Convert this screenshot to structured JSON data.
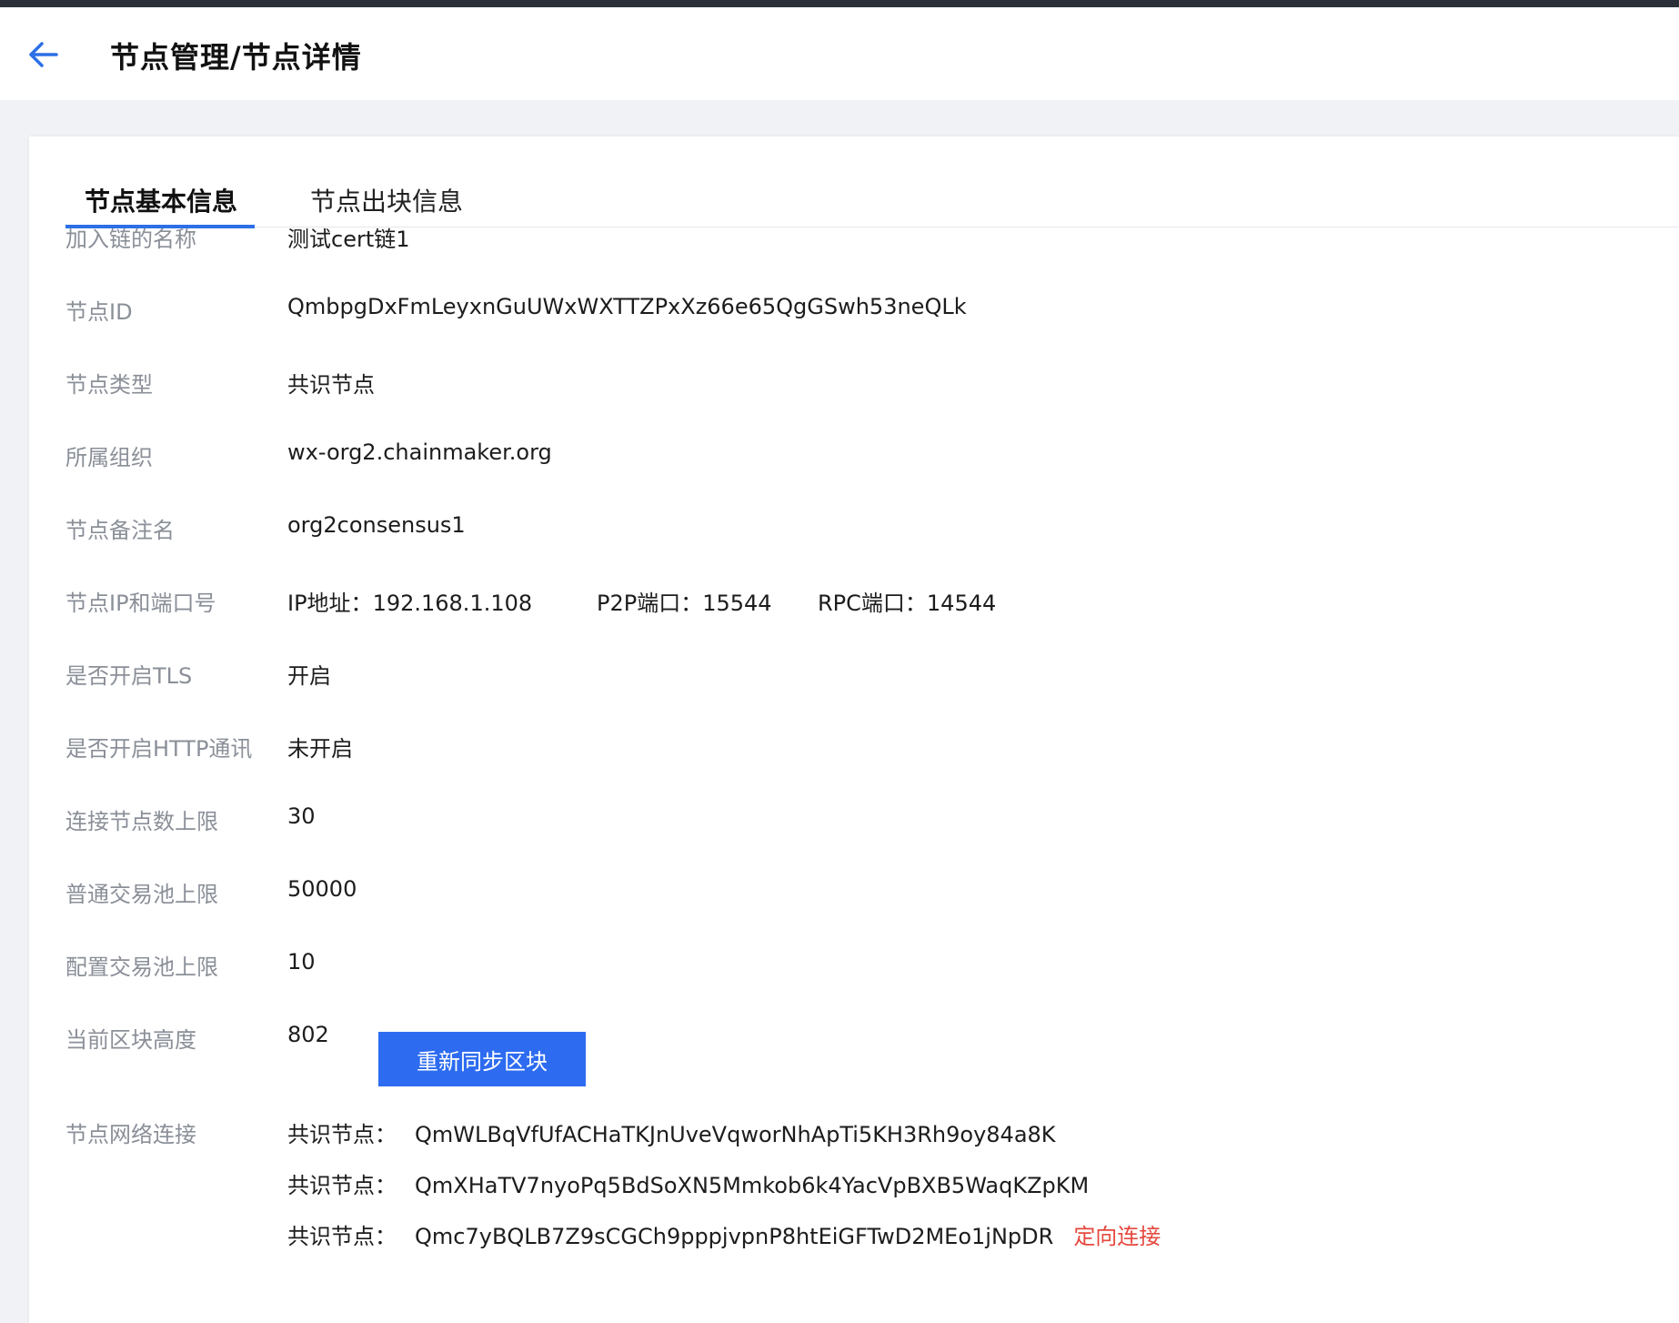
{
  "header": {
    "title": "节点管理/节点详情"
  },
  "tabs": [
    {
      "label": "节点基本信息",
      "active": true
    },
    {
      "label": "节点出块信息",
      "active": false
    }
  ],
  "details": {
    "chain_name": {
      "label": "加入链的名称",
      "value": "测试cert链1"
    },
    "node_id": {
      "label": "节点ID",
      "value": "QmbpgDxFmLeyxnGuUWxWXTTZPxXz66e65QgGSwh53neQLk"
    },
    "node_type": {
      "label": "节点类型",
      "value": "共识节点"
    },
    "org": {
      "label": "所属组织",
      "value": "wx-org2.chainmaker.org"
    },
    "remark": {
      "label": "节点备注名",
      "value": "org2consensus1"
    },
    "ip_ports": {
      "label": "节点IP和端口号",
      "ip_label": "IP地址：",
      "ip": "192.168.1.108",
      "p2p_label": "P2P端口：",
      "p2p": "15544",
      "rpc_label": "RPC端口：",
      "rpc": "14544"
    },
    "tls": {
      "label": "是否开启TLS",
      "value": "开启"
    },
    "http": {
      "label": "是否开启HTTP通讯",
      "value": "未开启"
    },
    "max_conn": {
      "label": "连接节点数上限",
      "value": "30"
    },
    "tx_pool": {
      "label": "普通交易池上限",
      "value": "50000"
    },
    "config_pool": {
      "label": "配置交易池上限",
      "value": "10"
    },
    "block_height": {
      "label": "当前区块高度",
      "value": "802",
      "button": "重新同步区块"
    },
    "network": {
      "label": "节点网络连接",
      "connections": [
        {
          "type": "共识节点：",
          "id": "QmWLBqVfUfACHaTKJnUveVqworNhApTi5KH3Rh9oy84a8K"
        },
        {
          "type": "共识节点：",
          "id": "QmXHaTV7nyoPq5BdSoXN5Mmkob6k4YacVpBXB5WaqKZpKM"
        },
        {
          "type": "共识节点：",
          "id": "Qmc7yBQLB7Z9sCGCh9pppjvpnP8htEiGFTwD2MEo1jNpDR",
          "action": "定向连接"
        }
      ]
    }
  },
  "colors": {
    "accent": "#2d6cf0",
    "link_red": "#e5483e",
    "label_gray": "#8a8f98"
  }
}
